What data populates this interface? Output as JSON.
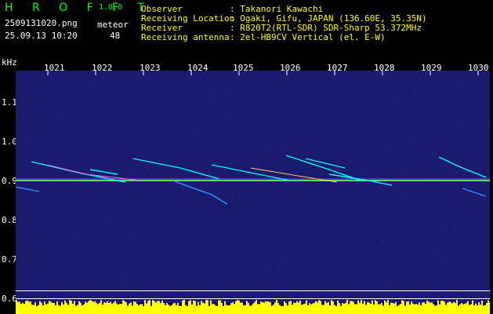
{
  "header": {
    "brand": "H R O F F T",
    "version": "1.0.0",
    "filename": "2509131020.png",
    "timestamp": "25.09.13 10:20",
    "meteor_label": "meteor",
    "meteor_count": "48"
  },
  "info": {
    "rows": [
      {
        "label": "Observer",
        "value": ": Takanori Kawachi"
      },
      {
        "label": "Receiving Location",
        "value": ": Ogaki, Gifu, JAPAN (136.60E, 35.35N)"
      },
      {
        "label": "Receiver",
        "value": ": R820T2(RTL-SDR) SDR-Sharp 53.372MHz"
      },
      {
        "label": "Receiving antenna",
        "value": ": 2el-HB9CV Vertical (el. E-W)"
      }
    ]
  },
  "axis": {
    "unit": "kHz",
    "x_ticks": [
      "1021",
      "1022",
      "1023",
      "1024",
      "1025",
      "1026",
      "1027",
      "1028",
      "1029",
      "1030"
    ],
    "y_ticks": [
      "1.1",
      "1.0",
      "0.9",
      "0.8",
      "0.7",
      "0.6"
    ]
  },
  "colors": {
    "background": "#1a1a6e",
    "noise": "#2d2da0",
    "signal": "#00ffff",
    "carrier": "#66ff66",
    "bar": "#ffff00",
    "bar_base": "#00ccff"
  }
}
